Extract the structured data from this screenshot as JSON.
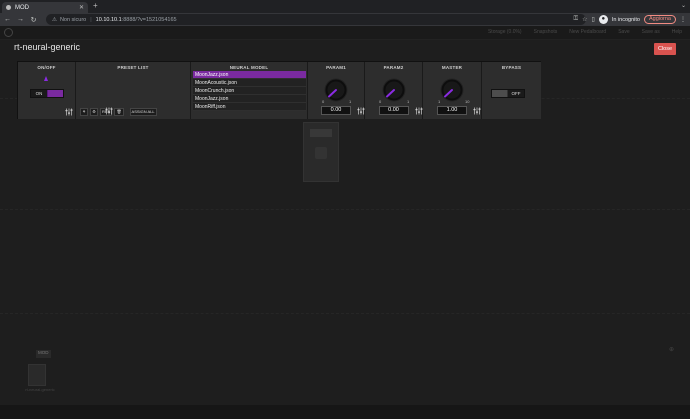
{
  "browser": {
    "tab_title": "MOD",
    "tab_close": "✕",
    "new_tab": "+",
    "tab_menu": "⌄",
    "security_label": "Non sicuro",
    "url_host": "10.10.10.1",
    "url_tail": ":8888/?v=1521054165",
    "incognito_label": "In incognito",
    "update_label": "Aggiorna",
    "update_menu": "⋮"
  },
  "app": {
    "topnav": [
      "Storage (0.0%)",
      "Snapshots",
      "New Pedalboard",
      "Save",
      "Save as",
      "Help"
    ],
    "bottom_tabs": [
      "",
      "",
      "MOD",
      "",
      "",
      "",
      "",
      "",
      "",
      "",
      "",
      "",
      "",
      "",
      "",
      "",
      "",
      ""
    ],
    "plugin_thumb_label": "rt-neural-generic",
    "status_items": [
      "",
      "",
      "",
      "",
      "",
      ""
    ]
  },
  "modal": {
    "title": "rt-neural-generic",
    "close_label": "Close"
  },
  "controls": {
    "onoff": {
      "label": "ON/OFF",
      "state_label": "ON"
    },
    "preset_list": {
      "label": "PRESET LIST",
      "rename_label": "REN",
      "assign_all_label": "ASSIGN ALL"
    },
    "neural_model": {
      "label": "NEURAL MODEL",
      "items": [
        "MoonJazz.json",
        "MoonAcoustic.json",
        "MoonCrunch.json",
        "MoonJazz.json",
        "MoonRiff.json"
      ],
      "selected_index": 0
    },
    "param1": {
      "label": "PARAM1",
      "min": "0",
      "max": "1",
      "value": "0.00"
    },
    "param2": {
      "label": "PARAM2",
      "min": "0",
      "max": "1",
      "value": "0.00"
    },
    "master": {
      "label": "MASTER",
      "min": "1",
      "max": "10",
      "value": "1.00"
    },
    "bypass": {
      "label": "BYPASS",
      "state_label": "OFF"
    }
  },
  "colors": {
    "accent": "#7a2aa0",
    "close_button": "#d9534f",
    "panel_bg": "#2d2d2d"
  }
}
